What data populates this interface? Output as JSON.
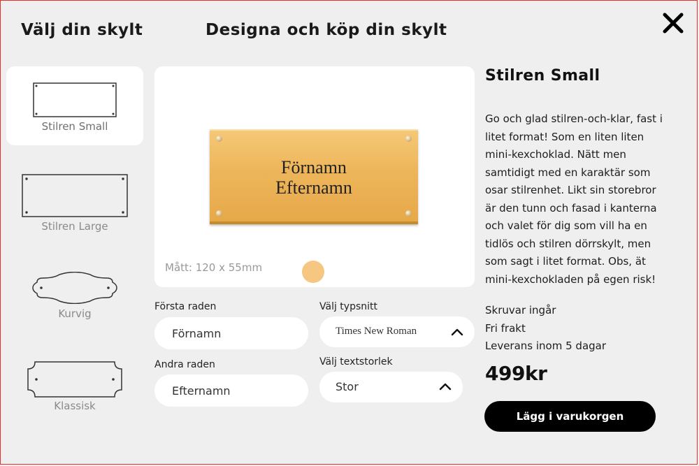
{
  "header": {
    "left_title": "Välj din skylt",
    "center_title": "Designa och köp din skylt",
    "close_icon": "close-icon"
  },
  "sign_options": [
    {
      "label": "Stilren Small",
      "selected": true
    },
    {
      "label": "Stilren Large",
      "selected": false
    },
    {
      "label": "Kurvig",
      "selected": false
    },
    {
      "label": "Klassisk",
      "selected": false
    }
  ],
  "preview": {
    "line1": "Förnamn",
    "line2": "Efternamn",
    "dimensions": "Mått: 120 x 55mm",
    "plate_color": "#edb55a",
    "swatch_color": "#f5c780"
  },
  "form": {
    "first_row_label": "Första raden",
    "first_row_value": "Förnamn",
    "second_row_label": "Andra raden",
    "second_row_value": "Efternamn",
    "font_label": "Välj typsnitt",
    "font_value": "Times New Roman",
    "size_label": "Välj textstorlek",
    "size_value": "Stor"
  },
  "product": {
    "title": "Stilren Small",
    "description": "Go och glad stilren-och-klar, fast i litet format! Som en liten liten mini-kexchoklad. Nätt men samtidigt med en karaktär som osar stilrenhet. Likt sin storebror är den tunn och fasad i kanterna och valet för dig som vill ha en tidlös och stilren dörrskylt, men som sagt i litet format. Obs, ät mini-kexchokladen på egen risk!",
    "info1": "Skruvar ingår",
    "info2": "Fri frakt",
    "info3": "Leverans inom 5 dagar",
    "price": "499kr",
    "cart_button": "Lägg i varukorgen"
  },
  "colors": {
    "background": "#efefef",
    "accent": "#000000",
    "frame_border": "#e2332a"
  }
}
